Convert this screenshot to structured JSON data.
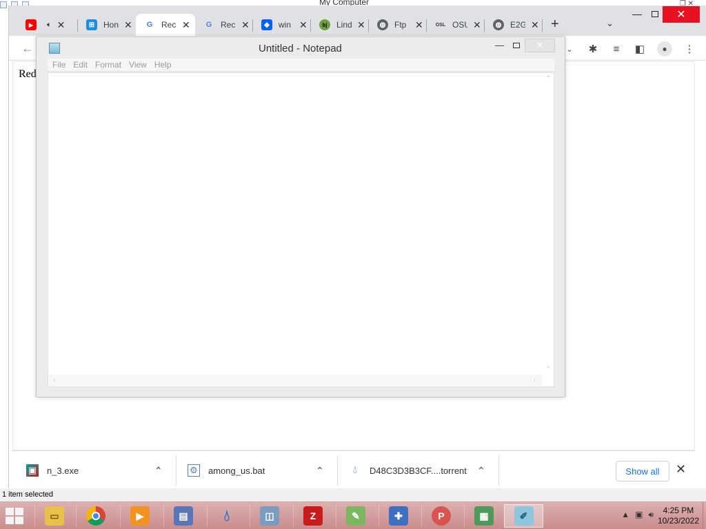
{
  "explorer": {
    "title": "My Computer",
    "status": "1 item selected"
  },
  "chrome": {
    "tabs": [
      {
        "label": "",
        "icon": "youtube-icon",
        "audio": true
      },
      {
        "label": "Hon",
        "icon": "windows-icon"
      },
      {
        "label": "Rec",
        "icon": "google-icon",
        "active": true
      },
      {
        "label": "Rec",
        "icon": "google-icon"
      },
      {
        "label": "win",
        "icon": "dropbox-icon"
      },
      {
        "label": "Lind",
        "icon": "bj-icon"
      },
      {
        "label": "Ftp",
        "icon": "globe-icon"
      },
      {
        "label": "OSU",
        "icon": "osu-icon"
      },
      {
        "label": "E2G",
        "icon": "globe-icon"
      }
    ],
    "close_glyph": "✕",
    "new_tab_glyph": "+",
    "tab_search_glyph": "⌄",
    "page_text": "Red",
    "accent_color": "#1a73e8"
  },
  "notepad": {
    "title": "Untitled - Notepad",
    "menu": [
      "File",
      "Edit",
      "Format",
      "View",
      "Help"
    ],
    "content": ""
  },
  "downloads": {
    "items": [
      {
        "name": "n_3.exe",
        "icon": "exe-icon"
      },
      {
        "name": "among_us.bat",
        "icon": "bat-icon"
      },
      {
        "name": "D48C3D3B3CF....torrent",
        "icon": "torrent-icon"
      }
    ],
    "show_all": "Show all"
  },
  "taskbar": {
    "apps": [
      {
        "name": "file-explorer",
        "icon": "folder-icon",
        "color": "#e8c04a"
      },
      {
        "name": "chrome",
        "icon": "chrome-icon",
        "color": "#db4437"
      },
      {
        "name": "media-player",
        "icon": "media-player-icon",
        "color": "#f29220"
      },
      {
        "name": "my-computer",
        "icon": "computer-icon",
        "color": "#5876b8"
      },
      {
        "name": "drop-app",
        "icon": "drop-icon",
        "color": "#2e6fd1"
      },
      {
        "name": "monitor",
        "icon": "monitor-icon",
        "color": "#7a9cc0"
      },
      {
        "name": "filezilla",
        "icon": "filezilla-icon",
        "color": "#c91b1b"
      },
      {
        "name": "notepadpp",
        "icon": "notepadpp-icon",
        "color": "#7bb661"
      },
      {
        "name": "puzzle-app",
        "icon": "puzzle-icon",
        "color": "#3f6fc0"
      },
      {
        "name": "paint",
        "icon": "palette-icon",
        "color": "#d9534f"
      },
      {
        "name": "notes",
        "icon": "notes-icon",
        "color": "#4e9a5a"
      },
      {
        "name": "notepad",
        "icon": "notepad-icon",
        "color": "#8ec6df",
        "active": true
      }
    ],
    "time": "4:25 PM",
    "date": "10/23/2022"
  }
}
